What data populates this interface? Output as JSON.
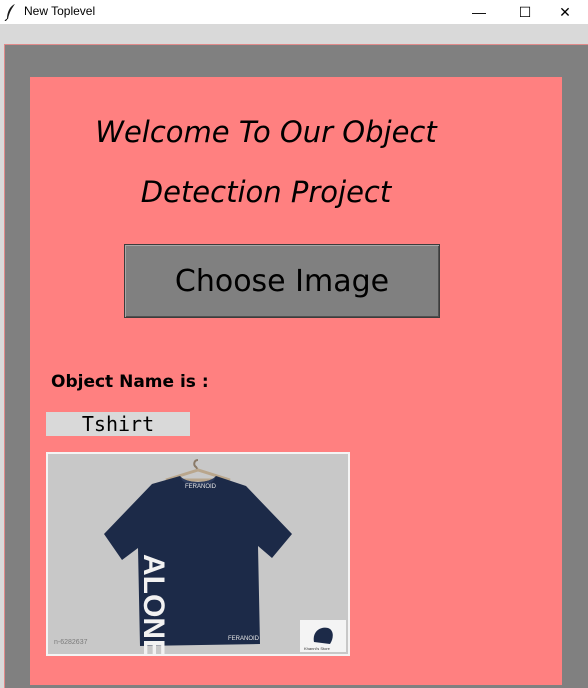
{
  "window": {
    "title": "New Toplevel",
    "minimize_glyph": "—",
    "maximize_glyph": "☐",
    "close_glyph": "✕"
  },
  "main": {
    "heading_line1": "Welcome To Our Object",
    "heading_line2": "Detection Project",
    "choose_button": "Choose Image",
    "object_label": "Object Name is :",
    "object_value": "Tshirt"
  },
  "image": {
    "shirt_brand_collar": "FERANOID",
    "shirt_print": "ALONE",
    "hem_brand": "FERANOID",
    "product_code": "n-6282637",
    "corner_logo_text": "Khanni's Store"
  },
  "colors": {
    "panel": "#ff8080",
    "outer": "#808080",
    "button": "#808080",
    "shirt": "#1c2a48",
    "result_bg": "#d9d9d9"
  }
}
